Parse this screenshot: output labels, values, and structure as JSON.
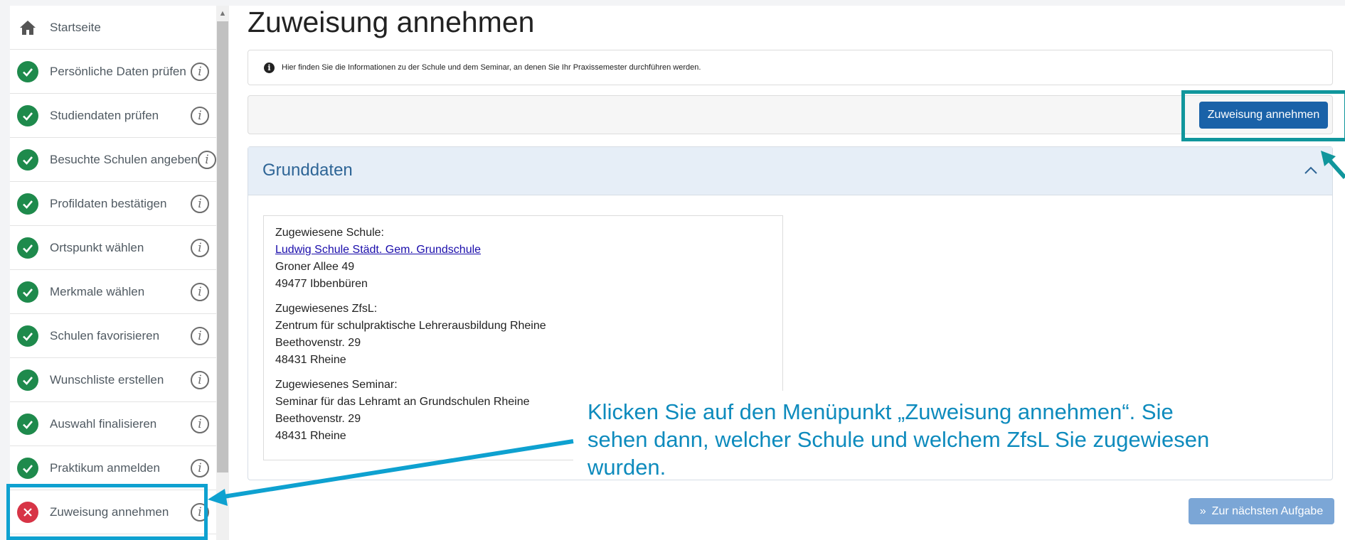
{
  "sidebar": {
    "home_label": "Startseite",
    "items": [
      {
        "label": "Persönliche Daten prüfen",
        "status": "done"
      },
      {
        "label": "Studiendaten prüfen",
        "status": "done"
      },
      {
        "label": "Besuchte Schulen angeben",
        "status": "done"
      },
      {
        "label": "Profildaten bestätigen",
        "status": "done"
      },
      {
        "label": "Ortspunkt wählen",
        "status": "done"
      },
      {
        "label": "Merkmale wählen",
        "status": "done"
      },
      {
        "label": "Schulen favorisieren",
        "status": "done"
      },
      {
        "label": "Wunschliste erstellen",
        "status": "done"
      },
      {
        "label": "Auswahl finalisieren",
        "status": "done"
      },
      {
        "label": "Praktikum anmelden",
        "status": "done"
      },
      {
        "label": "Zuweisung annehmen",
        "status": "open"
      }
    ],
    "info_glyph": "i"
  },
  "main": {
    "title": "Zuweisung annehmen",
    "info_text": "Hier finden Sie die Informationen zu der Schule und dem Seminar, an denen Sie Ihr Praxissemester durchführen werden.",
    "accept_button": "Zuweisung annehmen",
    "card_title": "Grunddaten",
    "school": {
      "heading": "Zugewiesene Schule:",
      "name": "Ludwig Schule Städt. Gem. Grundschule",
      "street": "Groner Allee 49",
      "city": "49477 Ibbenbüren"
    },
    "zfsl": {
      "heading": "Zugewiesenes ZfsL:",
      "name": "Zentrum für schulpraktische Lehrerausbildung Rheine",
      "street": "Beethovenstr. 29",
      "city": "48431 Rheine"
    },
    "seminar": {
      "heading": "Zugewiesenes Seminar:",
      "name": "Seminar für das Lehramt an Grundschulen Rheine",
      "street": "Beethovenstr. 29",
      "city": "48431 Rheine"
    },
    "next_button": "Zur nächsten Aufgabe",
    "next_glyph": "»"
  },
  "annotation": {
    "callout_text": "Klicken Sie auf den Menüpunkt „Zuweisung annehmen“. Sie sehen dann, welcher Schule und welchem ZfsL Sie zugewiesen wurden."
  },
  "colors": {
    "done": "#1e8a4c",
    "open": "#d73446",
    "accent": "#1a62a8",
    "highlight_teal": "#10969c",
    "highlight_blue": "#0ea1d0",
    "callout_text": "#0e8bbd"
  }
}
